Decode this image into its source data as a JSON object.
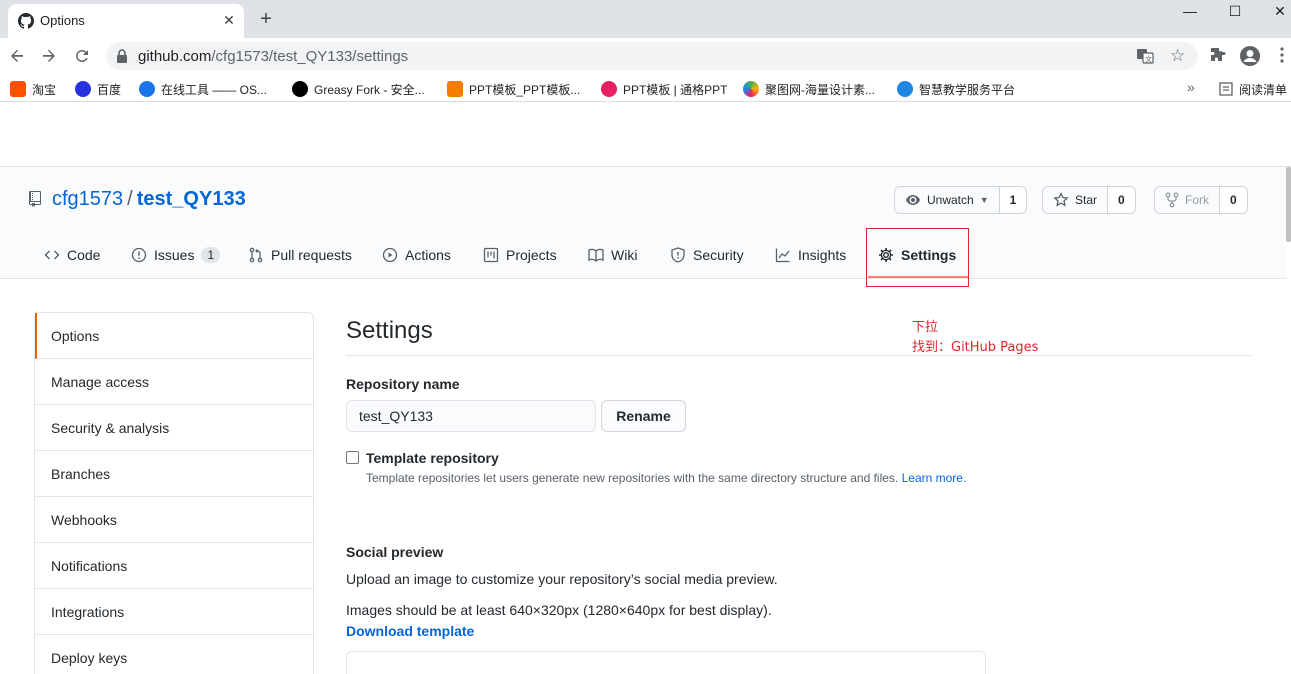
{
  "browser": {
    "tab_title": "Options",
    "close_glyph": "✕",
    "new_tab_glyph": "+",
    "window": {
      "minimize": "—",
      "maximize": "☐",
      "close": "✕"
    },
    "url_host": "github.com",
    "url_path": "/cfg1573/test_QY133/settings",
    "bookmarks": [
      "淘宝",
      "百度",
      "在线工具 —— OS...",
      "Greasy Fork - 安全...",
      "PPT模板_PPT模板...",
      "PPT模板 | 通格PPT",
      "聚图网-海量设计素...",
      "智慧教学服务平台"
    ],
    "bookmark_colors": [
      "#ff5000",
      "#2932e1",
      "#1a73e8",
      "#000000",
      "#f57c00",
      "#e91e63",
      "#ffb300",
      "#1e88e5"
    ],
    "more_bookmarks": "»",
    "reading_list": "阅读清单"
  },
  "repo": {
    "owner": "cfg1573",
    "separator": "/",
    "name": "test_QY133",
    "watch": {
      "label": "Unwatch",
      "count": "1"
    },
    "star": {
      "label": "Star",
      "count": "0"
    },
    "fork": {
      "label": "Fork",
      "count": "0"
    }
  },
  "nav": {
    "code": "Code",
    "issues": "Issues",
    "issues_count": "1",
    "pull_requests": "Pull requests",
    "actions": "Actions",
    "projects": "Projects",
    "wiki": "Wiki",
    "security": "Security",
    "insights": "Insights",
    "settings": "Settings"
  },
  "sidebar": {
    "items": [
      "Options",
      "Manage access",
      "Security & analysis",
      "Branches",
      "Webhooks",
      "Notifications",
      "Integrations",
      "Deploy keys"
    ]
  },
  "main": {
    "title": "Settings",
    "annotation_line1": "下拉",
    "annotation_line2": "找到：GitHub Pages",
    "repo_name_label": "Repository name",
    "repo_name_value": "test_QY133",
    "rename_button": "Rename",
    "template_label": "Template repository",
    "template_note": "Template repositories let users generate new repositories with the same directory structure and files.",
    "learn_more": "Learn more.",
    "social_title": "Social preview",
    "social_desc": "Upload an image to customize your repository’s social media preview.",
    "social_size": "Images should be at least 640×320px (1280×640px for best display).",
    "download_template": "Download template"
  },
  "colors": {
    "link": "#0366d6",
    "selected_tab_underline": "#f9826c",
    "sidebar_selected": "#e36209",
    "annotation": "#e0262c"
  }
}
